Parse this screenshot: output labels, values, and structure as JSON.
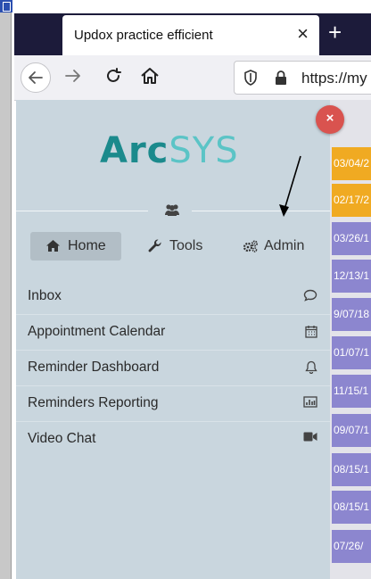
{
  "browser": {
    "tab_title": "Updox practice efficient",
    "tab_close": "×",
    "new_tab": "+",
    "url_text": "https://my"
  },
  "app": {
    "logo_part1": "Arc",
    "logo_part2": "SYS",
    "nav": {
      "home": "Home",
      "tools": "Tools",
      "admin": "Admin"
    },
    "close_symbol": "×",
    "menu_items": [
      {
        "label": "Inbox",
        "icon": "chat-icon"
      },
      {
        "label": "Appointment Calendar",
        "icon": "calendar-icon"
      },
      {
        "label": "Reminder Dashboard",
        "icon": "bell-icon"
      },
      {
        "label": "Reminders Reporting",
        "icon": "bar-chart-icon"
      },
      {
        "label": "Video Chat",
        "icon": "video-camera-icon"
      }
    ],
    "colors": {
      "logo_dark": "#1b8a8c",
      "logo_light": "#5bc4c6",
      "panel_bg": "#c9d6de",
      "close_red": "#d9534f"
    }
  },
  "background_list": {
    "dates": [
      "03/04/2",
      "02/17/2",
      "03/26/1",
      "12/13/1",
      "9/07/18",
      "01/07/1",
      "11/15/1",
      "09/07/1",
      "08/15/1",
      "08/15/1",
      "07/26/"
    ],
    "colors": {
      "highlight": "#f0aa22",
      "normal": "#8c86cf"
    }
  }
}
